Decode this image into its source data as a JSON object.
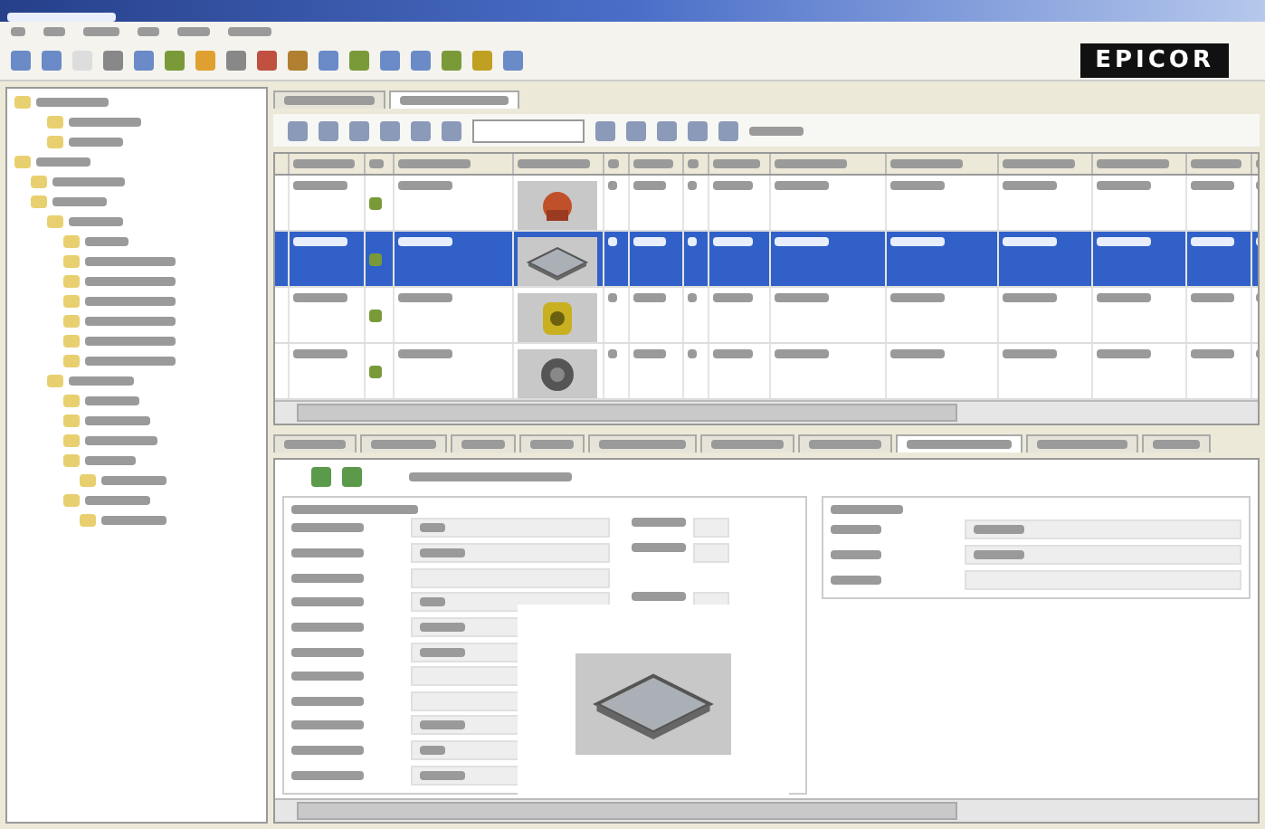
{
  "logo": {
    "text": "EPICOR"
  },
  "grid": {
    "rows": [
      {
        "selected": false,
        "kind": "red-part"
      },
      {
        "selected": true,
        "kind": "plate"
      },
      {
        "selected": false,
        "kind": "yellow-part"
      },
      {
        "selected": false,
        "kind": "disc"
      }
    ]
  }
}
